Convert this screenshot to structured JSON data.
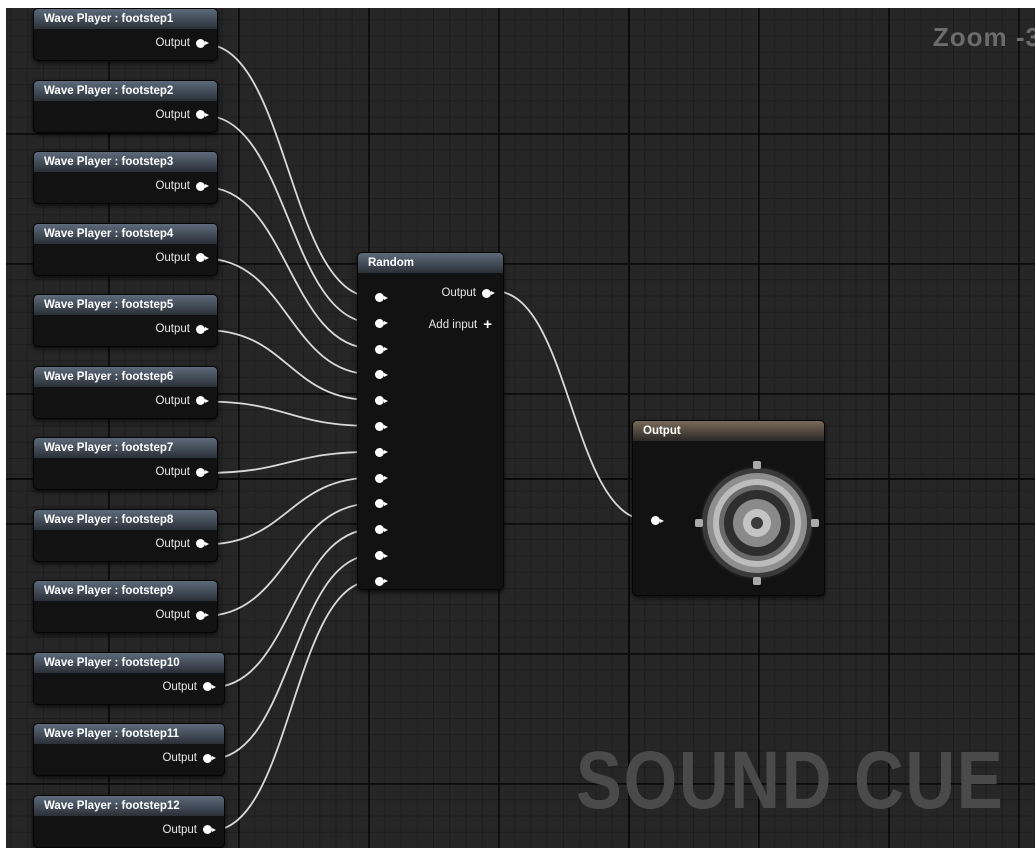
{
  "zoom_label": "Zoom -3",
  "watermark": "SOUND CUE",
  "wave_players": [
    {
      "title": "Wave Player : footstep1",
      "output": "Output"
    },
    {
      "title": "Wave Player : footstep2",
      "output": "Output"
    },
    {
      "title": "Wave Player : footstep3",
      "output": "Output"
    },
    {
      "title": "Wave Player : footstep4",
      "output": "Output"
    },
    {
      "title": "Wave Player : footstep5",
      "output": "Output"
    },
    {
      "title": "Wave Player : footstep6",
      "output": "Output"
    },
    {
      "title": "Wave Player : footstep7",
      "output": "Output"
    },
    {
      "title": "Wave Player : footstep8",
      "output": "Output"
    },
    {
      "title": "Wave Player : footstep9",
      "output": "Output"
    },
    {
      "title": "Wave Player : footstep10",
      "output": "Output"
    },
    {
      "title": "Wave Player : footstep11",
      "output": "Output"
    },
    {
      "title": "Wave Player : footstep12",
      "output": "Output"
    }
  ],
  "random_node": {
    "title": "Random",
    "output": "Output",
    "add_input": "Add input",
    "input_count": 12
  },
  "output_node": {
    "title": "Output",
    "icon": "speaker-icon"
  },
  "colors": {
    "graph_bg": "#262626",
    "wire": "#d9d9d9",
    "header_blue": "#4a5563",
    "header_brown": "#6a5c50"
  }
}
